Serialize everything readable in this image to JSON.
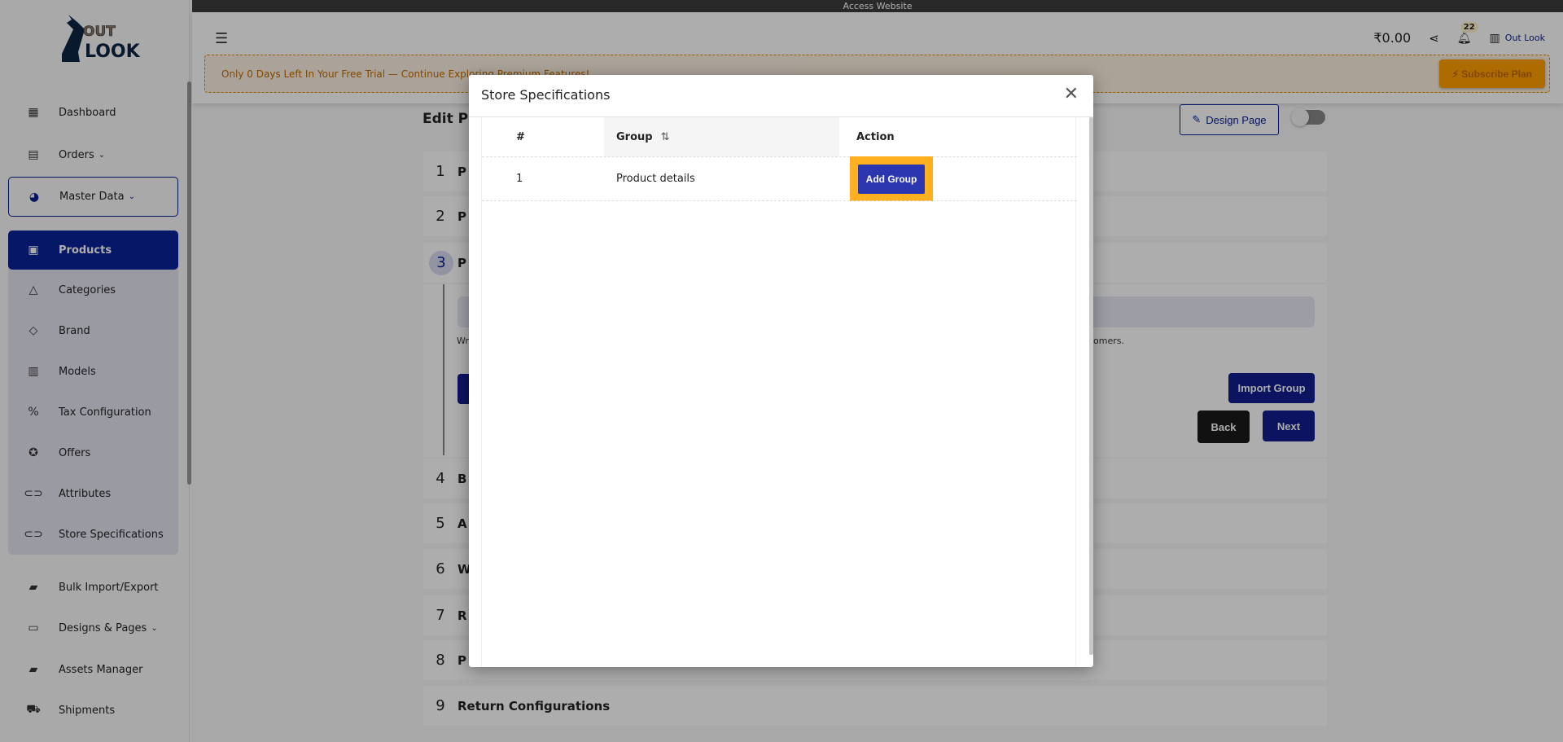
{
  "topbar": {
    "label": "Access Website"
  },
  "brand": {
    "logo_text": "OUT LOOK"
  },
  "sidebar": {
    "items": [
      {
        "label": "Dashboard",
        "icon": "dashboard-icon"
      },
      {
        "label": "Orders",
        "icon": "orders-icon"
      },
      {
        "label": "Master Data",
        "icon": "chart-icon"
      },
      {
        "label": "Products",
        "icon": "archive-icon"
      },
      {
        "label": "Categories",
        "icon": "shapes-icon"
      },
      {
        "label": "Brand",
        "icon": "tag-icon"
      },
      {
        "label": "Models",
        "icon": "models-icon"
      },
      {
        "label": "Tax Configuration",
        "icon": "percent-icon"
      },
      {
        "label": "Offers",
        "icon": "badge-check-icon"
      },
      {
        "label": "Attributes",
        "icon": "toggle-icon"
      },
      {
        "label": "Store Specifications",
        "icon": "toggle-icon"
      },
      {
        "label": "Bulk Import/Export",
        "icon": "folder-icon"
      },
      {
        "label": "Designs & Pages",
        "icon": "monitor-icon"
      },
      {
        "label": "Assets Manager",
        "icon": "folder-icon"
      },
      {
        "label": "Shipments",
        "icon": "truck-icon"
      }
    ]
  },
  "header": {
    "balance": "₹0.00",
    "notifications": "22",
    "store_name": "Out Look"
  },
  "banner": {
    "text": "Only 0 Days Left In Your Free Trial — Continue Exploring Premium Features!",
    "button": "Subscribe Plan"
  },
  "page": {
    "title": "Edit Pr",
    "design_button": "Design Page",
    "steps": [
      {
        "num": "1",
        "label": "P"
      },
      {
        "num": "2",
        "label": "P"
      },
      {
        "num": "3",
        "label": "P"
      },
      {
        "num": "4",
        "label": "B"
      },
      {
        "num": "5",
        "label": "A"
      },
      {
        "num": "6",
        "label": "W"
      },
      {
        "num": "7",
        "label": "R"
      },
      {
        "num": "8",
        "label": "P"
      },
      {
        "num": "9",
        "label": "Return Configurations"
      }
    ],
    "desc_left": "Wr",
    "desc_right": "omers.",
    "import_button": "Import Group",
    "back_button": "Back",
    "next_button": "Next"
  },
  "modal": {
    "title": "Store Specifications",
    "columns": [
      "#",
      "Group",
      "Action"
    ],
    "rows": [
      {
        "index": "1",
        "group": "Product details",
        "action": "Add Group"
      }
    ],
    "highlight_color": "#ffb020"
  }
}
